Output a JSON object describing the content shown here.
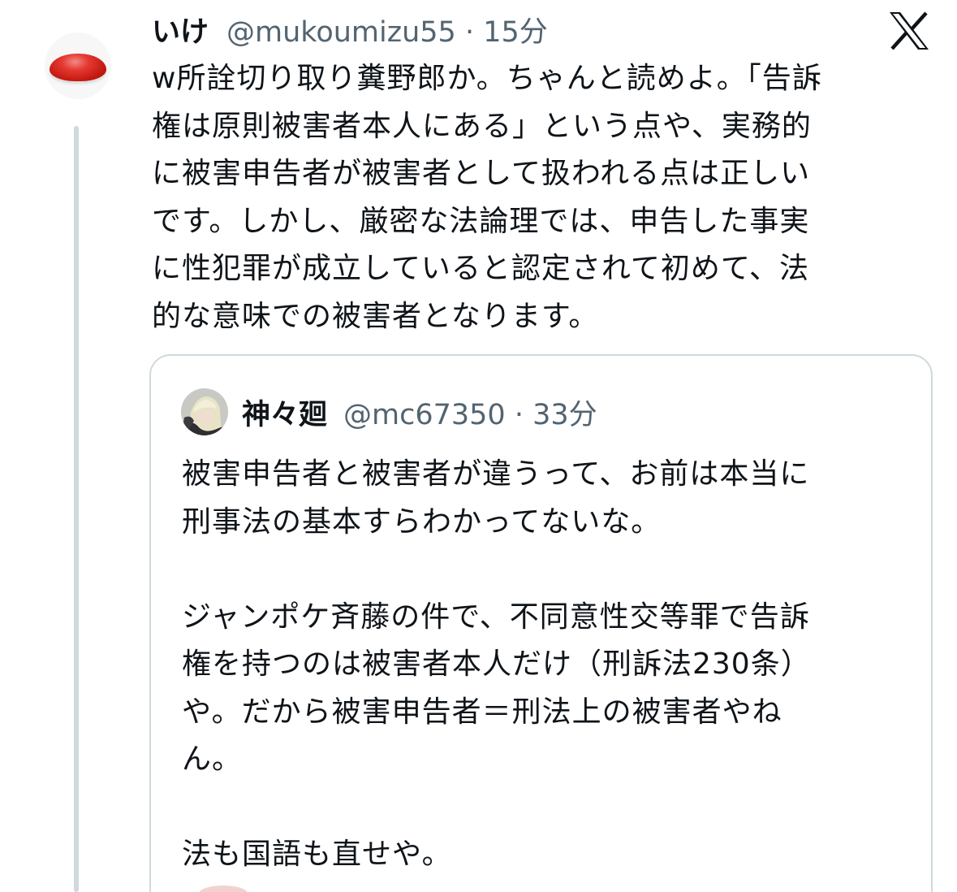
{
  "tweet": {
    "display_name": "いけ",
    "handle_time": "@mukoumizu55 · 15分",
    "text": "w所詮切り取り糞野郎か。ちゃんと読めよ。「告訴\n権は原則被害者本人にある」という点や、実務的\nに被害申告者が被害者として扱われる点は正しい\nです。しかし、厳密な法論理では、申告した事実\nに性犯罪が成立していると認定されて初めて、法\n的な意味での被害者となります。",
    "avatar_icon": "red-blob-avatar-icon",
    "brand_icon": "x-logo-icon"
  },
  "quote": {
    "display_name": "神々廻",
    "handle_time": "@mc67350 · 33分",
    "text": "被害申告者と被害者が違うって、お前は本当に\n刑事法の基本すらわかってないな。\n\nジャンポケ斉藤の件で、不同意性交等罪で告訴\n権を持つのは被害者本人だけ（刑訴法230条）\nや。だから被害申告者＝刑法上の被害者やね\nん。\n\n法も国語も直せや。",
    "avatar_icon": "anime-character-avatar-icon"
  },
  "colors": {
    "text_primary": "#0f1419",
    "text_secondary": "#536471",
    "border": "#cfd9de",
    "avatar_red": "#d8231a",
    "background": "#ffffff"
  }
}
